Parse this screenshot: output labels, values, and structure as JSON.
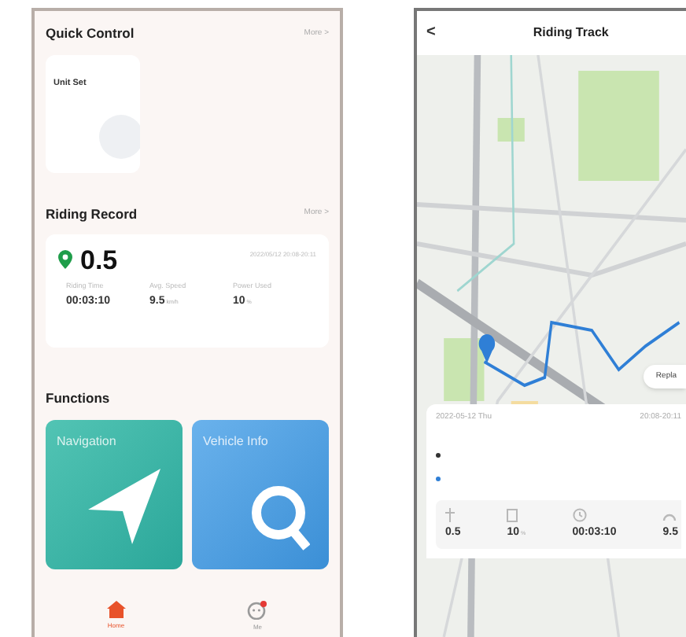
{
  "home": {
    "quick_control": {
      "title": "Quick Control",
      "more": "More >",
      "cards": [
        {
          "label": "Unit Set"
        }
      ]
    },
    "riding_record": {
      "title": "Riding Record",
      "more": "More >",
      "distance": "0.5",
      "datetime": "2022/05/12 20:08-20:11",
      "stats": [
        {
          "label": "Riding Time",
          "value": "00:03:10"
        },
        {
          "label": "Avg. Speed",
          "value": "9.5",
          "unit": "km/h"
        },
        {
          "label": "Power Used",
          "value": "10",
          "unit": "%"
        }
      ]
    },
    "functions": {
      "title": "Functions",
      "tiles": [
        {
          "label": "Navigation",
          "kind": "navigation"
        },
        {
          "label": "Vehicle Info",
          "kind": "vehicle"
        }
      ]
    },
    "tab_bar": [
      {
        "label": "Home",
        "kind": "home",
        "selected": true
      },
      {
        "label": "Me",
        "kind": "me",
        "selected": false
      }
    ]
  },
  "riding_track": {
    "title": "Riding Track",
    "back": "<",
    "replay": "Repla",
    "date": "2022-05-12 Thu",
    "time": "20:08-20:11",
    "legend": [
      {
        "color": "#333333"
      },
      {
        "color": "#2f7fd6"
      }
    ],
    "stats": [
      {
        "kind": "distance",
        "value": "0.5"
      },
      {
        "kind": "power",
        "value": "10",
        "unit": "%"
      },
      {
        "kind": "time",
        "value": "00:03:10"
      },
      {
        "kind": "speed",
        "value": "9.5"
      }
    ]
  }
}
